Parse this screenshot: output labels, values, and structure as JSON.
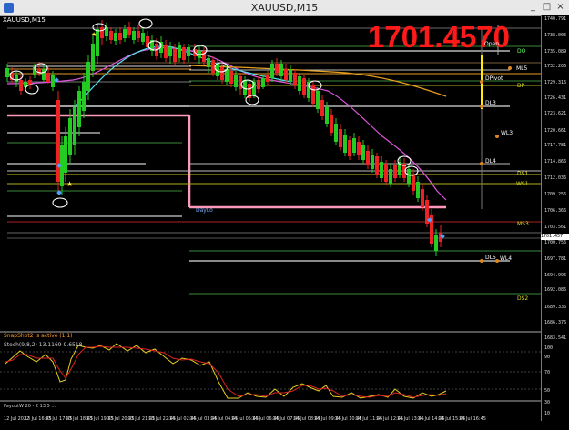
{
  "window": {
    "title": "XAUUSD,M15",
    "controls": [
      "_",
      "□",
      "×"
    ]
  },
  "chart": {
    "symbol_label": "XAUUSD,M15",
    "big_price": "1701.4570",
    "current_price_tag": "1701.457",
    "price_axis": [
      "1740.791",
      "1738.006",
      "1735.089",
      "1732.206",
      "1729.316",
      "1726.431",
      "1723.621",
      "1720.661",
      "1717.781",
      "1714.866",
      "1712.036",
      "1709.256",
      "1706.366",
      "1703.561",
      "1700.756",
      "1697.781",
      "1694.996",
      "1692.086",
      "1689.336",
      "1686.376",
      "1683.541",
      "100",
      "90",
      "70",
      "50",
      "30",
      "10",
      "0"
    ],
    "level_labels": {
      "DO": "DO",
      "ML5": "ML5",
      "DPivot": "DPivot",
      "DP": "DP",
      "DL3": "DL3",
      "WL3": "WL3",
      "DL4": "DL4",
      "DS1": "DS1",
      "WS1": "WS1",
      "DayLo": "DayLo",
      "MS3": "MS3",
      "DL5": "DL5",
      "WL4": "WL4",
      "DS2": "DS2"
    },
    "overlay_tag": "Open",
    "snapshot_text": "SnapShot2 is active (1,1)",
    "stoch_label": "Stoch(9,8,2) 13.1169 9.6518",
    "lower_label": "PayoutW 20 - 2 13.5 ...",
    "time_axis": [
      "12 Jul 2022",
      "13 Jul 16:45",
      "13 Jul 17:45",
      "13 Jul 18:45",
      "13 Jul 19:45",
      "13 Jul 20:45",
      "13 Jul 21:45",
      "13 Jul 22:45",
      "14 Jul 02:45",
      "14 Jul 03:45",
      "14 Jul 04:45",
      "14 Jul 05:45",
      "14 Jul 06:45",
      "14 Jul 07:45",
      "14 Jul 08:45",
      "14 Jul 09:45",
      "14 Jul 10:45",
      "14 Jul 11:45",
      "14 Jul 12:45",
      "14 Jul 13:45",
      "14 Jul 14:45",
      "14 Jul 15:45",
      "14 Jul 16:45"
    ]
  },
  "colors": {
    "background": "#000000",
    "bull": "#22cc22",
    "bear": "#ee2222",
    "price_text": "#ff1a1a"
  }
}
